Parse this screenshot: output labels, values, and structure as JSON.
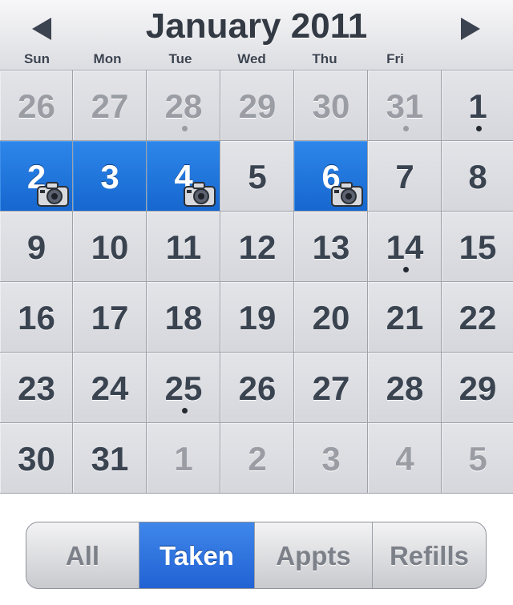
{
  "header": {
    "month_title": "January 2011",
    "prev_icon": "left-triangle-icon",
    "next_icon": "right-triangle-icon"
  },
  "weekdays": [
    "Sun",
    "Mon",
    "Tue",
    "Wed",
    "Thu",
    "Fri"
  ],
  "colors": {
    "selected": "#1a6fd9",
    "active_tab": "#3572e0",
    "text": "#3a4350",
    "muted": "#9a9da4"
  },
  "calendar": {
    "weeks": [
      [
        {
          "day": "26",
          "other": true
        },
        {
          "day": "27",
          "other": true
        },
        {
          "day": "28",
          "other": true,
          "dot": true
        },
        {
          "day": "29",
          "other": true
        },
        {
          "day": "30",
          "other": true
        },
        {
          "day": "31",
          "other": true,
          "dot": true
        },
        {
          "day": "1",
          "dot": true
        }
      ],
      [
        {
          "day": "2",
          "selected": true,
          "photo": true
        },
        {
          "day": "3",
          "selected": true
        },
        {
          "day": "4",
          "selected": true,
          "photo": true
        },
        {
          "day": "5"
        },
        {
          "day": "6",
          "selected": true,
          "photo": true
        },
        {
          "day": "7"
        },
        {
          "day": "8"
        }
      ],
      [
        {
          "day": "9"
        },
        {
          "day": "10"
        },
        {
          "day": "11"
        },
        {
          "day": "12"
        },
        {
          "day": "13"
        },
        {
          "day": "14",
          "dot": true
        },
        {
          "day": "15"
        }
      ],
      [
        {
          "day": "16"
        },
        {
          "day": "17"
        },
        {
          "day": "18"
        },
        {
          "day": "19"
        },
        {
          "day": "20"
        },
        {
          "day": "21"
        },
        {
          "day": "22"
        }
      ],
      [
        {
          "day": "23"
        },
        {
          "day": "24"
        },
        {
          "day": "25",
          "dot": true
        },
        {
          "day": "26"
        },
        {
          "day": "27"
        },
        {
          "day": "28"
        },
        {
          "day": "29"
        }
      ],
      [
        {
          "day": "30"
        },
        {
          "day": "31"
        },
        {
          "day": "1",
          "other": true
        },
        {
          "day": "2",
          "other": true
        },
        {
          "day": "3",
          "other": true
        },
        {
          "day": "4",
          "other": true
        },
        {
          "day": "5",
          "other": true
        }
      ]
    ]
  },
  "filter_tabs": [
    {
      "label": "All",
      "active": false
    },
    {
      "label": "Taken",
      "active": true
    },
    {
      "label": "Appts",
      "active": false
    },
    {
      "label": "Refills",
      "active": false
    }
  ]
}
